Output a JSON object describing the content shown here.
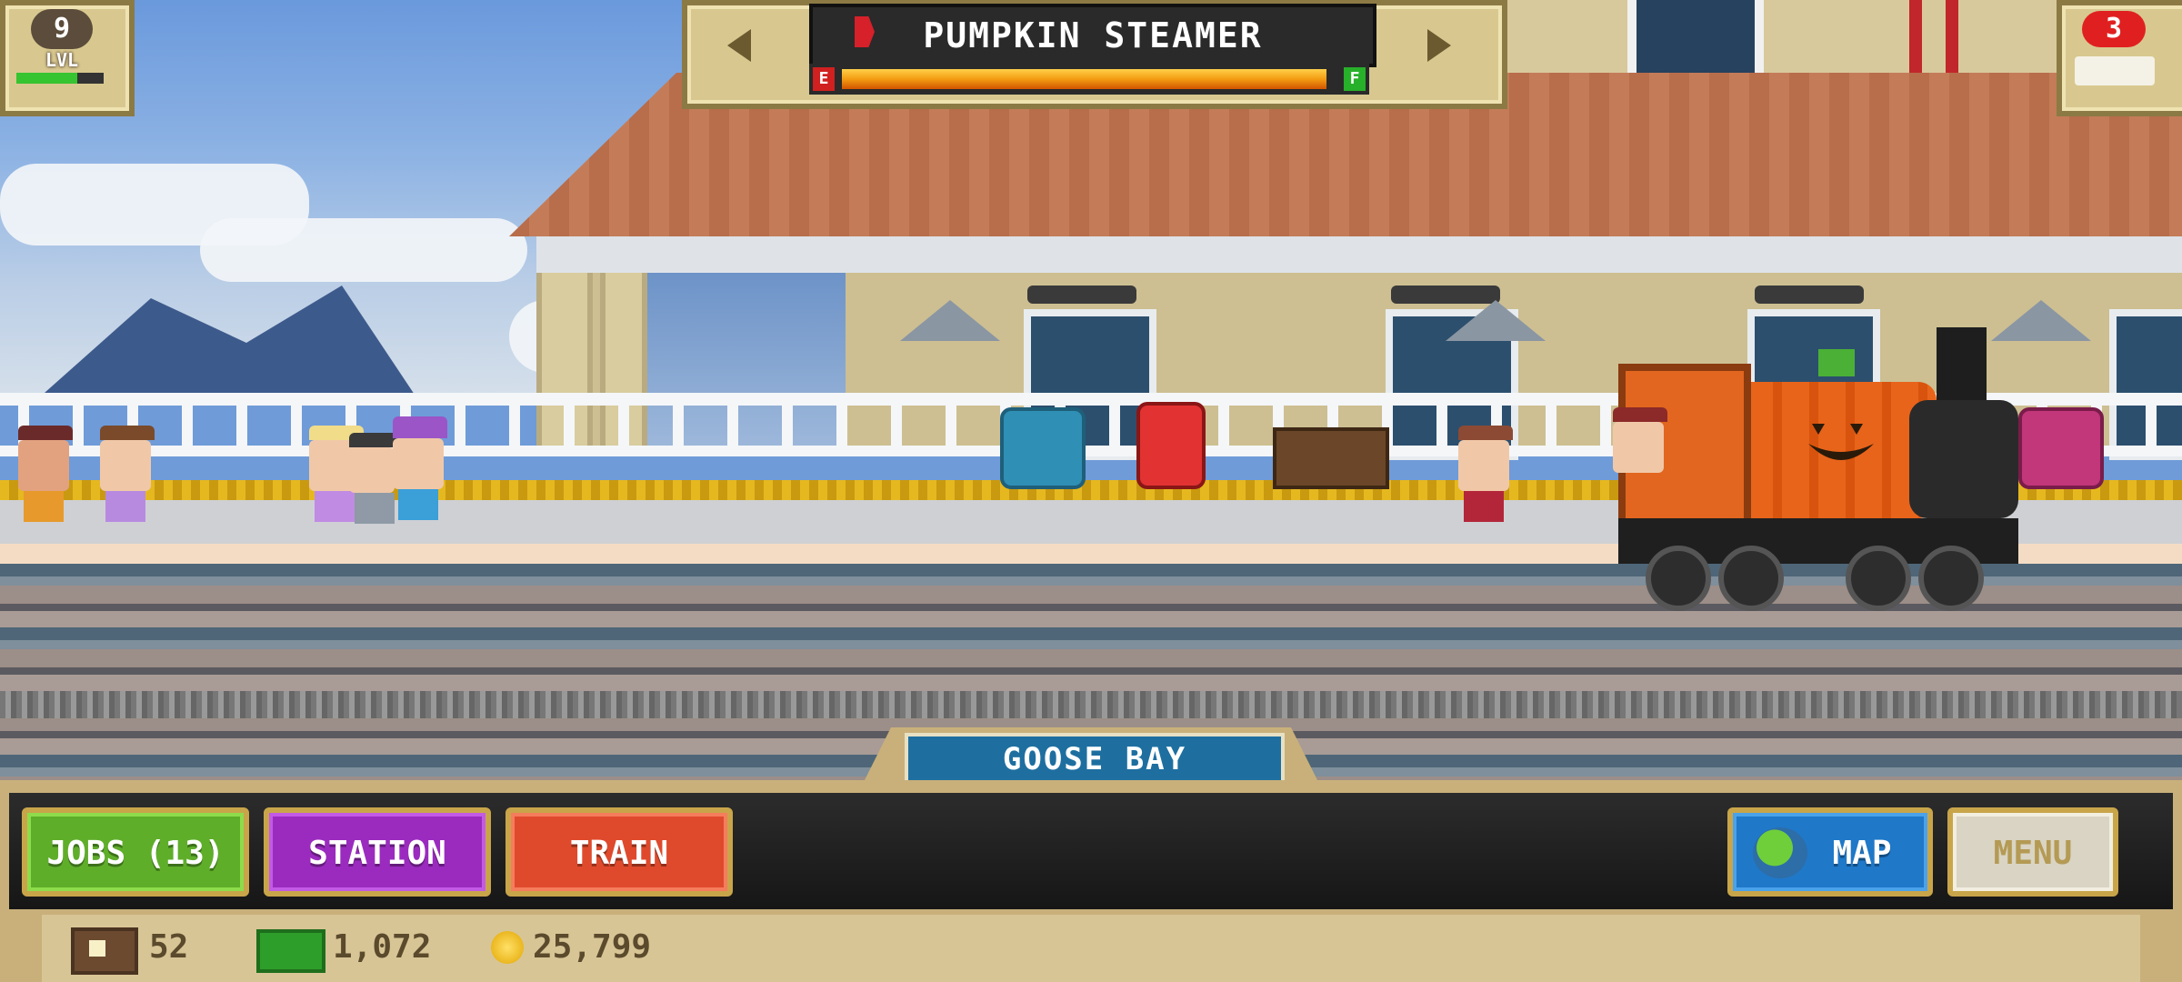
{
  "hud": {
    "level": {
      "number": "9",
      "label": "LVL",
      "progress": 0.7
    },
    "train_selector": {
      "train_name": "PUMPKIN STEAMER",
      "fuel_empty_label": "E",
      "fuel_full_label": "F",
      "fuel_level": 0.98
    },
    "trains_available": "3"
  },
  "station": {
    "name": "GOOSE BAY"
  },
  "buttons": {
    "jobs": "JOBS (13)",
    "station": "STATION",
    "train": "TRAIN",
    "map": "MAP",
    "menu": "MENU"
  },
  "resources": {
    "tickets": "52",
    "cash": "1,072",
    "coins": "25,799"
  },
  "colors": {
    "jobs": "#5fae2a",
    "station": "#9b2bbf",
    "train": "#df4a2c",
    "map": "#1f78c8",
    "fuel": "#f39c12"
  }
}
